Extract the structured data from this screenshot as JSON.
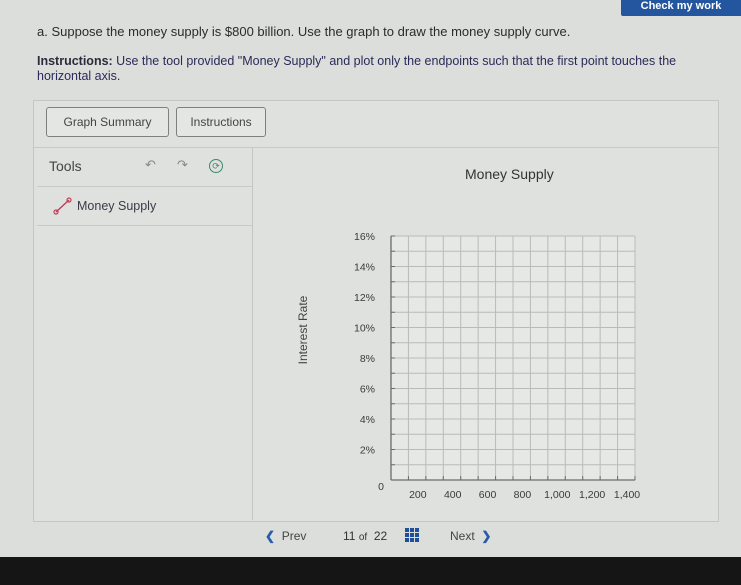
{
  "header": {
    "check_button": "Check my work"
  },
  "question": {
    "text": "a. Suppose the money supply is $800 billion. Use the graph to draw the money supply curve.",
    "instructions_label": "Instructions:",
    "instructions_text": " Use the tool provided \"Money Supply\" and plot only the endpoints such that the first point touches the horizontal axis."
  },
  "toolbar": {
    "graph_summary": "Graph Summary",
    "instructions": "Instructions"
  },
  "tools": {
    "title": "Tools",
    "undo_icon": "↶",
    "redo_icon": "↷",
    "reset_icon": "⟳",
    "items": [
      {
        "label": "Money Supply",
        "icon": "line-segment-tool-icon"
      }
    ]
  },
  "nav": {
    "prev": "Prev",
    "prev_chevron": "❮",
    "current": "11",
    "of": "of",
    "total": "22",
    "next": "Next",
    "next_chevron": "❯"
  },
  "chart_data": {
    "type": "scatter",
    "title": "Money Supply",
    "xlabel": "",
    "ylabel": "Interest Rate",
    "xlim": [
      0,
      1400
    ],
    "ylim": [
      0,
      16
    ],
    "x_minor_step": 100,
    "y_minor_step": 1,
    "x_ticks": [
      {
        "value": 0,
        "label": "0"
      },
      {
        "value": 200,
        "label": "200"
      },
      {
        "value": 400,
        "label": "400"
      },
      {
        "value": 600,
        "label": "600"
      },
      {
        "value": 800,
        "label": "800"
      },
      {
        "value": 1000,
        "label": "1,000"
      },
      {
        "value": 1200,
        "label": "1,200"
      },
      {
        "value": 1400,
        "label": "1,400"
      }
    ],
    "y_ticks": [
      {
        "value": 2,
        "label": "2%"
      },
      {
        "value": 4,
        "label": "4%"
      },
      {
        "value": 6,
        "label": "6%"
      },
      {
        "value": 8,
        "label": "8%"
      },
      {
        "value": 10,
        "label": "10%"
      },
      {
        "value": 12,
        "label": "12%"
      },
      {
        "value": 14,
        "label": "14%"
      },
      {
        "value": 16,
        "label": "16%"
      }
    ],
    "grid": true,
    "series": []
  },
  "colors": {
    "accent": "#24569f",
    "tool_icon": "#c0405a",
    "grid": "#b9bbb8",
    "axis": "#6a6c6a"
  }
}
